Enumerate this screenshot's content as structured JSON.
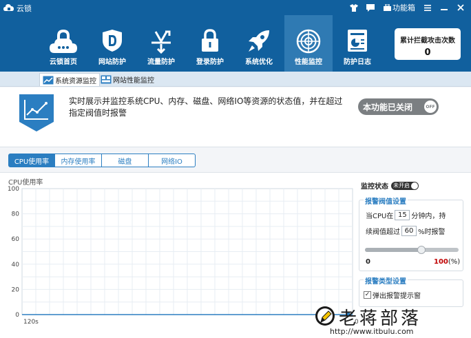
{
  "app": {
    "title": "云锁"
  },
  "titlebar": {
    "tools_label": "功能箱"
  },
  "nav": {
    "items": [
      {
        "label": "云锁首页"
      },
      {
        "label": "网站防护"
      },
      {
        "label": "流量防护"
      },
      {
        "label": "登录防护"
      },
      {
        "label": "系统优化"
      },
      {
        "label": "性能监控",
        "active": true
      },
      {
        "label": "防护日志"
      }
    ]
  },
  "counter": {
    "title": "累计拦截攻击次数",
    "value": "0"
  },
  "subtabs": [
    {
      "label": "系统资源监控",
      "active": true
    },
    {
      "label": "网站性能监控"
    }
  ],
  "intro": {
    "text": "实时展示并监控系统CPU、内存、磁盘、网络IO等资源的状态值，并在超过指定阀值时报警",
    "toggle_label": "本功能已关闭",
    "toggle_state": "OFF"
  },
  "metric_tabs": [
    {
      "label": "CPU使用率",
      "active": true
    },
    {
      "label": "内存使用率"
    },
    {
      "label": "磁盘"
    },
    {
      "label": "网络IO"
    }
  ],
  "chart_data": {
    "type": "line",
    "ylabel": "CPU使用率",
    "yticks": [
      "100",
      "80",
      "60",
      "40",
      "20",
      "0"
    ],
    "ylim": [
      0,
      100
    ],
    "x_start_label": "120s",
    "x_end_label": "0",
    "grid": true,
    "series": [
      {
        "values": [
          0
        ]
      }
    ]
  },
  "settings": {
    "monitor_label": "监控状态",
    "monitor_switch": "未开启",
    "threshold": {
      "legend": "报警阀值设置",
      "prefix": "当CPU在",
      "minutes": "15",
      "minutes_suffix": "分钟内，持",
      "line2_prefix": "续阀值超过",
      "percent": "60",
      "percent_suffix": "%时报警",
      "slider_min": "0",
      "slider_max": "100",
      "slider_unit": "(%)",
      "slider_value": 0.6
    },
    "alarm": {
      "legend": "报警类型设置",
      "checkbox_label": "弹出报警提示窗",
      "checked": true,
      "check_mark": "✓"
    }
  },
  "watermark": {
    "text": "老蒋部落",
    "url": "http://www.itbulu.com"
  },
  "colors": {
    "header": "#11609e",
    "accent": "#2b7ec1",
    "danger": "#c00000"
  }
}
